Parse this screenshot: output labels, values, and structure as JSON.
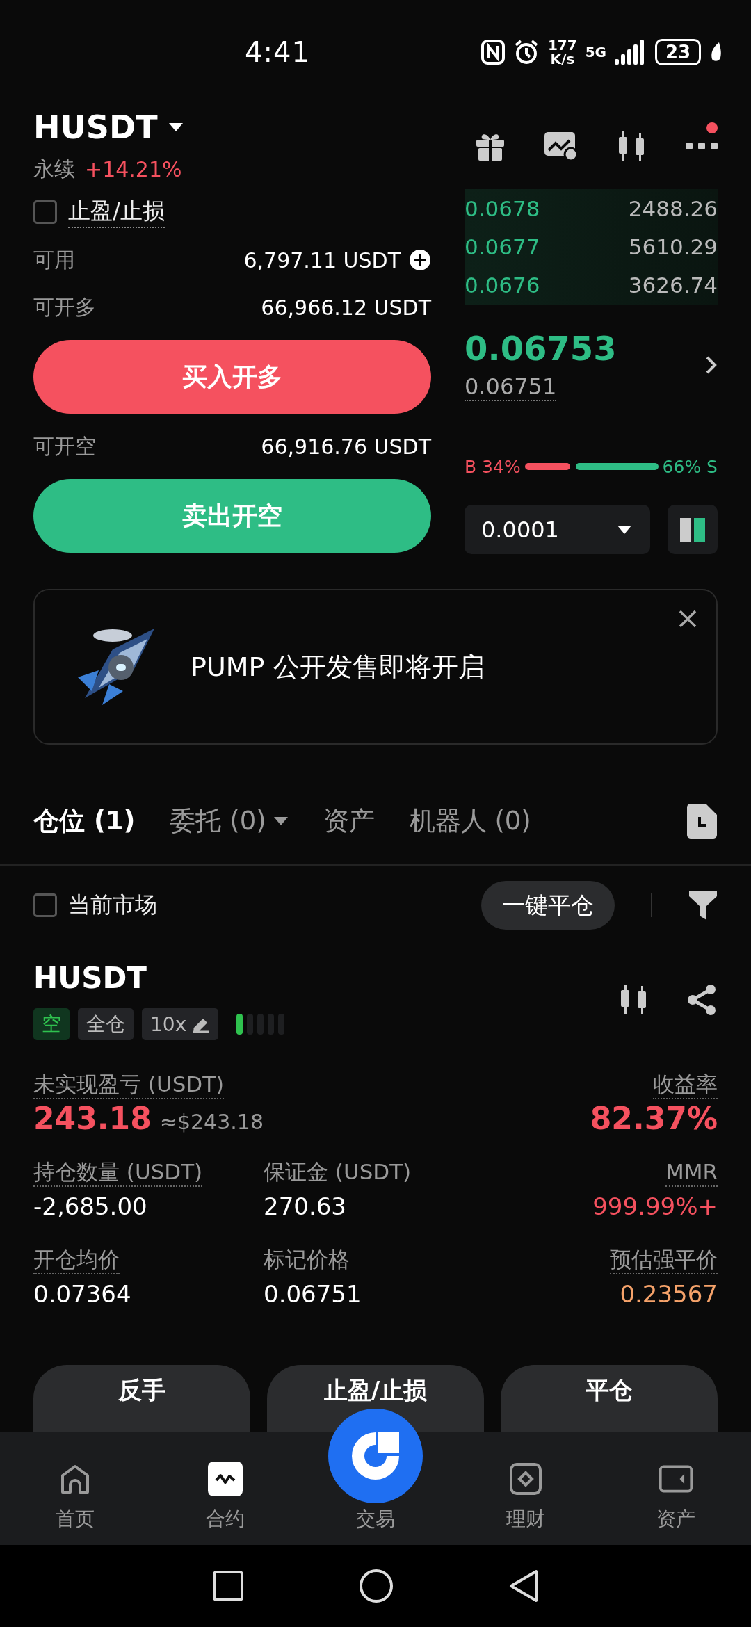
{
  "status_bar": {
    "time": "4:41",
    "speed_value": "177",
    "speed_unit": "K/s",
    "network": "5G",
    "battery": "23"
  },
  "header": {
    "symbol": "HUSDT",
    "contract_type": "永续",
    "change": "+14.21%",
    "notification_dot": true
  },
  "tpsl_toggle": {
    "label": "止盈/止损",
    "checked": false
  },
  "balances": [
    {
      "label": "可用",
      "value": "6,797.11 USDT",
      "kind": "add"
    },
    {
      "label": "可开多",
      "value": "66,966.12 USDT",
      "kind": "plain"
    }
  ],
  "buy_button": "买入开多",
  "short_balance": {
    "label": "可开空",
    "value": "66,916.76 USDT"
  },
  "sell_button": "卖出开空",
  "order_book": [
    {
      "price": "0.0678",
      "amount": "2488.26"
    },
    {
      "price": "0.0677",
      "amount": "5610.29"
    },
    {
      "price": "0.0676",
      "amount": "3626.74"
    }
  ],
  "last_price": "0.06753",
  "mark_price": "0.06751",
  "ratio": {
    "buy_label": "B 34%",
    "sell_label": "66% S",
    "level": 0.34
  },
  "tick_size": "0.0001",
  "banner": {
    "text": "PUMP 公开发售即将开启"
  },
  "tabs": [
    {
      "label": "仓位 (1)",
      "selected": true,
      "dropdown": false
    },
    {
      "label": "委托 (0)",
      "selected": false,
      "dropdown": true
    },
    {
      "label": "资产",
      "selected": false,
      "dropdown": false
    },
    {
      "label": "机器人 (0)",
      "selected": false,
      "dropdown": false
    }
  ],
  "filter": {
    "label": "当前市场",
    "checked": false,
    "close_all": "一键平仓"
  },
  "position": {
    "symbol": "HUSDT",
    "tags": [
      {
        "label": "空",
        "kind": "side"
      },
      {
        "label": "全仓",
        "kind": "plain"
      },
      {
        "label": "10x",
        "kind": "leverage"
      }
    ],
    "risk": {
      "level": 0.2
    },
    "pnl": {
      "label": "未实现盈亏 (USDT)",
      "value": "243.18",
      "approx": "≈$243.18"
    },
    "roe": {
      "label": "收益率",
      "value": "82.37%"
    },
    "metrics": [
      {
        "label": "持仓数量 (USDT)",
        "value": "-2,685.00",
        "dotted": true,
        "color": "#ffffff"
      },
      {
        "label": "保证金 (USDT)",
        "value": "270.63",
        "dotted": false,
        "color": "#ffffff"
      },
      {
        "label": "MMR",
        "value": "999.99%+",
        "dotted": true,
        "color": "#f5515f"
      },
      {
        "label": "开仓均价",
        "value": "0.07364",
        "dotted": true,
        "color": "#ffffff"
      },
      {
        "label": "标记价格",
        "value": "0.06751",
        "dotted": false,
        "color": "#ffffff"
      },
      {
        "label": "预估强平价",
        "value": "0.23567",
        "dotted": true,
        "color": "#f5a26a"
      }
    ],
    "actions": [
      "反手",
      "止盈/止损",
      "平仓"
    ]
  },
  "bottom_nav": [
    {
      "label": "首页",
      "selected": false,
      "kind": "tab"
    },
    {
      "label": "合约",
      "selected": true,
      "kind": "tab"
    },
    {
      "label": "交易",
      "selected": false,
      "kind": "center"
    },
    {
      "label": "理财",
      "selected": false,
      "kind": "tab"
    },
    {
      "label": "资产",
      "selected": false,
      "kind": "tab"
    }
  ]
}
